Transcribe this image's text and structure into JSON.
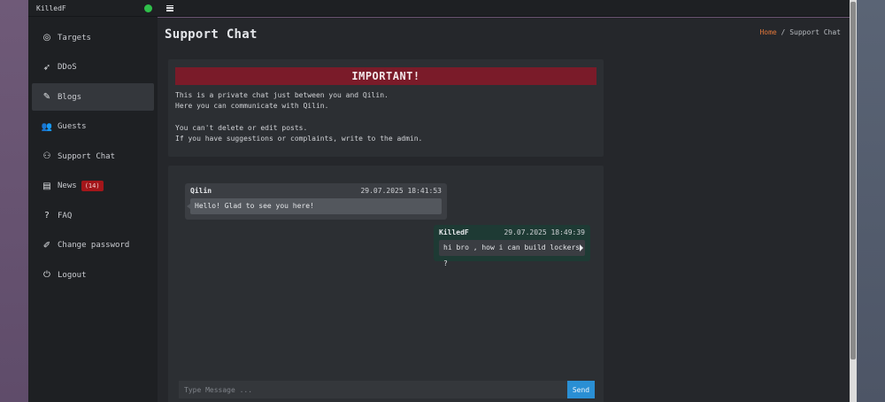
{
  "sidebar": {
    "username": "KilledF",
    "items": [
      {
        "label": "Targets",
        "icon": "target-icon",
        "glyph": "◎",
        "active": false
      },
      {
        "label": "DDoS",
        "icon": "rocket-icon",
        "glyph": "➶",
        "active": false
      },
      {
        "label": "Blogs",
        "icon": "blog-icon",
        "glyph": "✎",
        "active": true
      },
      {
        "label": "Guests",
        "icon": "users-icon",
        "glyph": "👥",
        "active": false
      },
      {
        "label": "Support Chat",
        "icon": "support-icon",
        "glyph": "⚇",
        "active": false
      },
      {
        "label": "News",
        "icon": "newspaper-icon",
        "glyph": "▤",
        "active": false,
        "badge": "(14)"
      },
      {
        "label": "FAQ",
        "icon": "question-icon",
        "glyph": "?",
        "active": false
      },
      {
        "label": "Change password",
        "icon": "edit-icon",
        "glyph": "✐",
        "active": false
      },
      {
        "label": "Logout",
        "icon": "power-icon",
        "glyph": "⏻",
        "active": false
      }
    ]
  },
  "page": {
    "title": "Support Chat",
    "breadcrumb": {
      "home": "Home",
      "separator": "/",
      "current": "Support Chat"
    }
  },
  "notice": {
    "heading": "IMPORTANT!",
    "line1": "This is a private chat just between you and Qilin.",
    "line2": "Here you can communicate with Qilin.",
    "line3": "You can't delete or edit posts.",
    "line4": "If you have suggestions or complaints, write to the admin."
  },
  "messages": [
    {
      "author": "Qilin",
      "time": "29.07.2025 18:41:53",
      "text": "Hello! Glad to see you here!"
    },
    {
      "author": "KilledF",
      "time": "29.07.2025 18:49:39",
      "text": "hi bro , how i can build lockers ?"
    }
  ],
  "composer": {
    "placeholder": "Type Message ...",
    "send_label": "Send"
  },
  "colors": {
    "accent": "#2a8fd4",
    "important": "#7a1b29",
    "breadcrumb_home": "#e0763a",
    "badge": "#a4161a"
  }
}
